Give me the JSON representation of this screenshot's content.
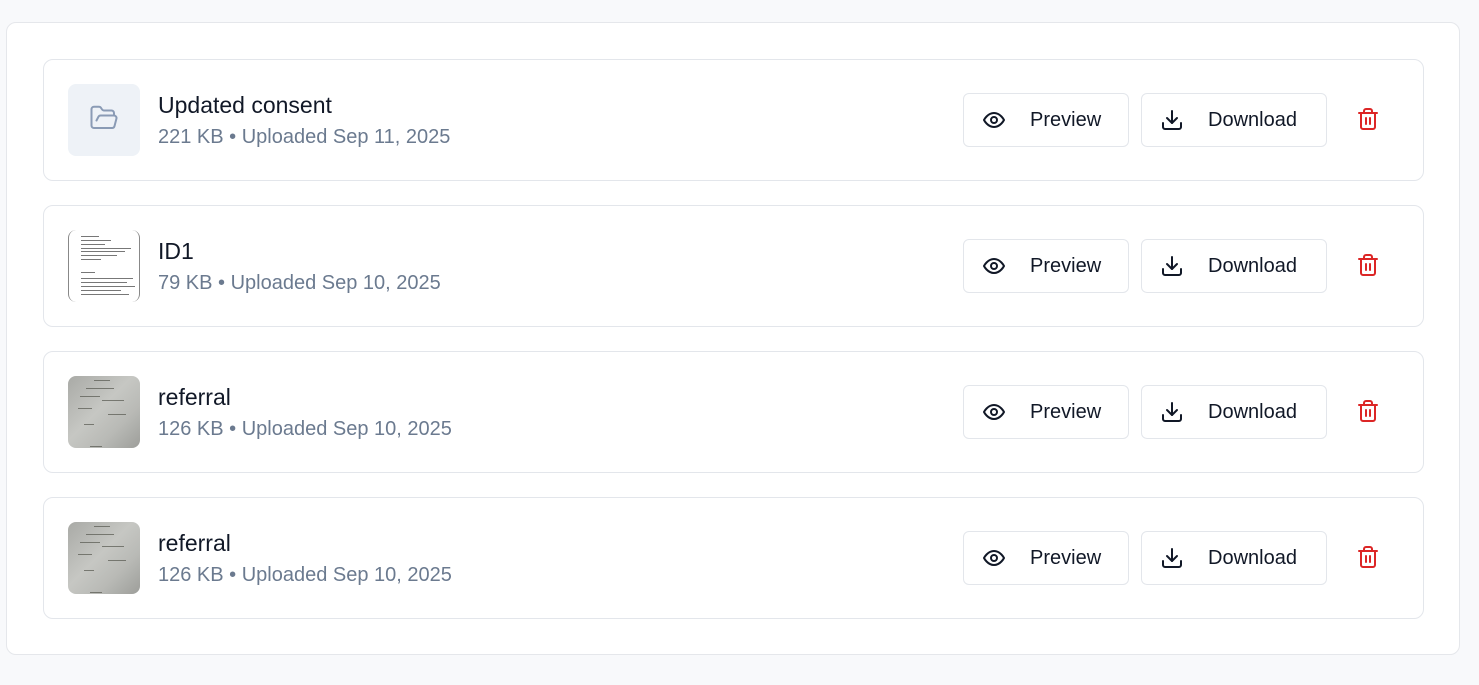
{
  "files": [
    {
      "name": "Updated consent",
      "info": "221 KB • Uploaded Sep 11, 2025",
      "thumb": "folder-open-icon",
      "preview_label": "Preview",
      "download_label": "Download"
    },
    {
      "name": "ID1",
      "info": "79 KB • Uploaded Sep 10, 2025",
      "thumb": "document-thumbnail",
      "preview_label": "Preview",
      "download_label": "Download"
    },
    {
      "name": "referral",
      "info": "126 KB • Uploaded Sep 10, 2025",
      "thumb": "photo-thumbnail",
      "preview_label": "Preview",
      "download_label": "Download"
    },
    {
      "name": "referral",
      "info": "126 KB • Uploaded Sep 10, 2025",
      "thumb": "photo-thumbnail",
      "preview_label": "Preview",
      "download_label": "Download"
    }
  ],
  "colors": {
    "delete": "#dc2626",
    "text_primary": "#111827",
    "text_secondary": "#6b7a8f",
    "folder_bg": "#eef2f7",
    "folder_icon": "#8a9bb5"
  }
}
